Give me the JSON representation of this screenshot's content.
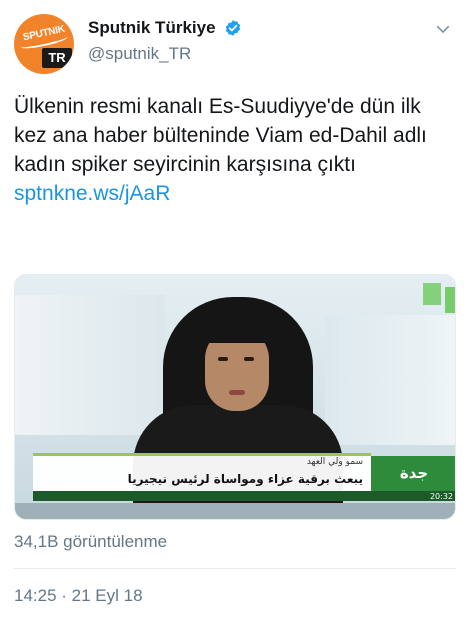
{
  "account": {
    "display_name": "Sputnik Türkiye",
    "handle": "@sputnik_TR",
    "avatar_logo_text": "SPUTNIK",
    "avatar_badge_text": "TR",
    "verified_icon": "verified-badge-icon",
    "menu_icon": "chevron-down-icon"
  },
  "tweet": {
    "text": "Ülkenin resmi kanalı Es-Suudiyye'de dün ilk kez ana haber bülteninde Viam ed-Dahil adlı kadın spiker seyircinin karşısına çıktı",
    "link": "sptnkne.ws/jAaR"
  },
  "media": {
    "lower_third_top": "سمو ولي العهد",
    "lower_third_main": "يبعث برقية عزاء ومواساة لرئيس نيجيريا",
    "city": "جدة",
    "clock": "20:32"
  },
  "views": "34,1B görüntülenme",
  "timestamp": "14:25 · 21 Eyl 18",
  "colors": {
    "link": "#1b95e0",
    "verified": "#1da1f2",
    "secondary_text": "#657786",
    "brand_orange": "#f1832a"
  }
}
